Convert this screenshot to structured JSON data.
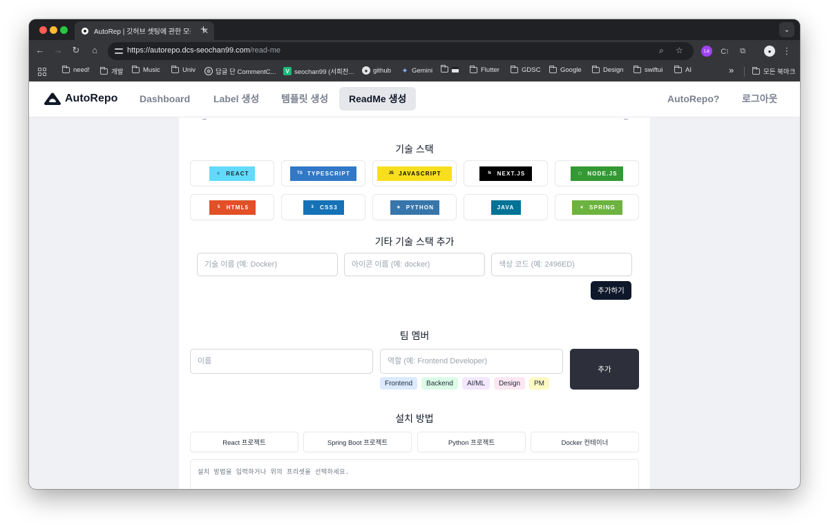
{
  "browser": {
    "tab_title": "AutoRep | 깃허브 셋팅에 관한 모든",
    "tab_close": "✕",
    "new_tab": "+",
    "tab_menu": "⌄",
    "url_host": "https://autorepo.dcs-seochan99.com",
    "url_path": "/read-me",
    "nav_back": "←",
    "nav_forward": "→",
    "nav_reload": "↻",
    "nav_home": "⌂",
    "zoom_icon": "⌕",
    "star_icon": "☆",
    "ext_la": "La",
    "ext_c": "C⁝",
    "ext_puzzle": "⧉",
    "profile": "●",
    "menu_dots": "⋮",
    "bookmarks_overflow": "»"
  },
  "bookmarks": [
    {
      "label": "need!",
      "type": "folder"
    },
    {
      "label": "개발",
      "type": "folder"
    },
    {
      "label": "Music",
      "type": "folder"
    },
    {
      "label": "Univ",
      "type": "folder"
    },
    {
      "label": "답글 단 CommentC...",
      "type": "openai"
    },
    {
      "label": "seochan99 (서희찬...",
      "type": "v"
    },
    {
      "label": "github",
      "type": "github"
    },
    {
      "label": "Gemini",
      "type": "gemini"
    },
    {
      "label": "",
      "type": "folder-flag"
    },
    {
      "label": "Flutter",
      "type": "folder"
    },
    {
      "label": "GDSC",
      "type": "folder"
    },
    {
      "label": "Google",
      "type": "folder"
    },
    {
      "label": "Design",
      "type": "folder"
    },
    {
      "label": "swiftui",
      "type": "folder"
    },
    {
      "label": "AI",
      "type": "folder"
    }
  ],
  "bookmarks_all": "모든 북마크",
  "site": {
    "logo_text": "AutoRepo",
    "nav": [
      {
        "label": "Dashboard",
        "active": false
      },
      {
        "label": "Label 생성",
        "active": false
      },
      {
        "label": "템플릿 생성",
        "active": false
      },
      {
        "label": "ReadMe 생성",
        "active": true
      }
    ],
    "right_nav": [
      "AutoRepo?",
      "로그아웃"
    ]
  },
  "tech_stack": {
    "title": "기술 스택",
    "items": [
      {
        "label": "REACT",
        "icon": "⚛",
        "bg": "#61dafb",
        "fg": "#20232a"
      },
      {
        "label": "TYPESCRIPT",
        "icon": "TS",
        "bg": "#3178c6",
        "fg": "#ffffff"
      },
      {
        "label": "JAVASCRIPT",
        "icon": "JS",
        "bg": "#f7df1e",
        "fg": "#000000"
      },
      {
        "label": "NEXT.JS",
        "icon": "N",
        "bg": "#000000",
        "fg": "#ffffff"
      },
      {
        "label": "NODE.JS",
        "icon": "⬡",
        "bg": "#339933",
        "fg": "#ffffff"
      },
      {
        "label": "HTML5",
        "icon": "5",
        "bg": "#e34f26",
        "fg": "#ffffff"
      },
      {
        "label": "CSS3",
        "icon": "3",
        "bg": "#1572b6",
        "fg": "#ffffff"
      },
      {
        "label": "PYTHON",
        "icon": "✚",
        "bg": "#3776ab",
        "fg": "#ffffff"
      },
      {
        "label": "JAVA",
        "icon": "",
        "bg": "#007396",
        "fg": "#ffffff"
      },
      {
        "label": "SPRING",
        "icon": "❦",
        "bg": "#6db33f",
        "fg": "#ffffff"
      }
    ]
  },
  "custom_stack": {
    "title": "기타 기술 스택 추가",
    "name_placeholder": "기술 이름 (예: Docker)",
    "icon_placeholder": "아이콘 이름 (예: docker)",
    "color_placeholder": "색상 코드 (예: 2496ED)",
    "add_label": "추가하기"
  },
  "team": {
    "title": "팀 멤버",
    "name_placeholder": "이름",
    "role_placeholder": "역할 (예: Frontend Developer)",
    "add_label": "추가",
    "roles": [
      {
        "label": "Frontend",
        "bg": "#dbeafe"
      },
      {
        "label": "Backend",
        "bg": "#dcfce7"
      },
      {
        "label": "AI/ML",
        "bg": "#f3e8ff"
      },
      {
        "label": "Design",
        "bg": "#fce7f3"
      },
      {
        "label": "PM",
        "bg": "#fef9c3"
      }
    ]
  },
  "install": {
    "title": "설치 방법",
    "presets": [
      "React 프로젝트",
      "Spring Boot 프로젝트",
      "Python 프로젝트",
      "Docker 컨테이너"
    ],
    "placeholder": "설치 방법을 입력하거나 위의 프리셋을 선택하세요."
  }
}
